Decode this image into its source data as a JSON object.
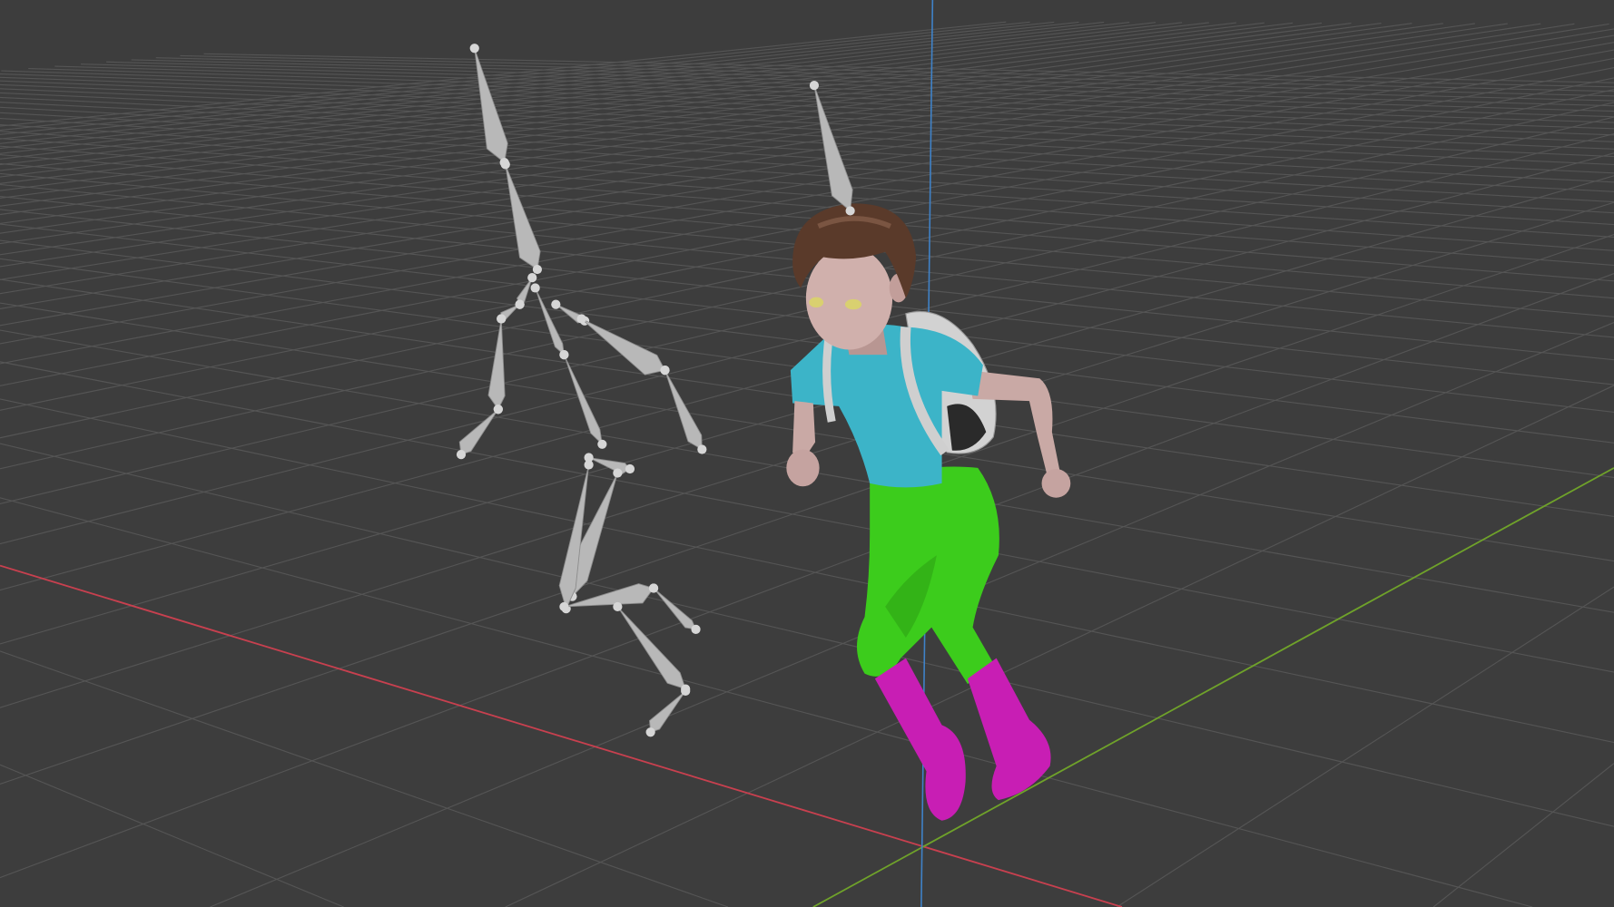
{
  "viewport": {
    "background": "#3d3d3d",
    "grid_color": "#555555",
    "axis_colors": {
      "x": "#c8404f",
      "y": "#6fa22a",
      "z": "#3f82c8"
    },
    "bone_color": "#b8b8b8",
    "character_colors": {
      "skin": "#c9a9a5",
      "hair": "#5a3a2a",
      "shirt": "#3cb4c8",
      "pants": "#3ccc1c",
      "boots": "#c81eb4",
      "backpack": "#d4d4d4"
    }
  }
}
